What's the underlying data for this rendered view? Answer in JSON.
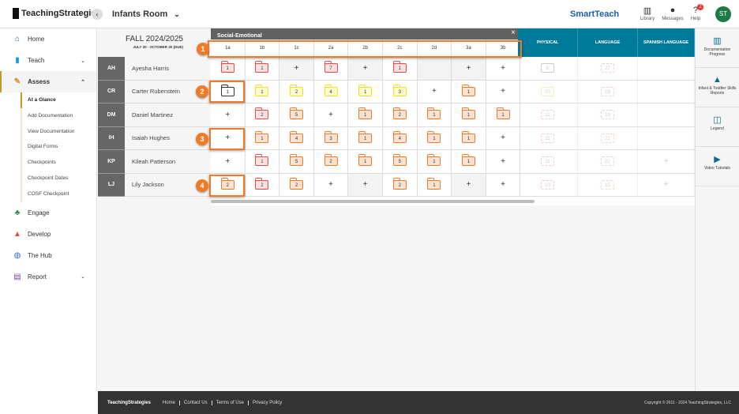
{
  "app": {
    "logo": "TeachingStrategies",
    "room": "Infants Room",
    "product": "SmartTeach",
    "library": "Library",
    "messages": "Messages",
    "help": "Help",
    "help_badge": "2",
    "avatar": "ST"
  },
  "sidebar": {
    "items": [
      {
        "label": "Home",
        "icon": "home-icon",
        "glyph": "⌂",
        "color": "#1a4f8c"
      },
      {
        "label": "Teach",
        "icon": "book-icon",
        "glyph": "▮",
        "color": "#1a9ad6",
        "chev": "⌄"
      },
      {
        "label": "Assess",
        "icon": "clipboard-icon",
        "glyph": "✎",
        "color": "#c8962c",
        "chev": "⌃"
      },
      {
        "label": "Engage",
        "icon": "people-icon",
        "glyph": "♣",
        "color": "#2a8a4a"
      },
      {
        "label": "Develop",
        "icon": "graduation-cap-icon",
        "glyph": "▲",
        "color": "#e84a2a"
      },
      {
        "label": "The Hub",
        "icon": "globe-icon",
        "glyph": "◍",
        "color": "#2a6ac8"
      },
      {
        "label": "Report",
        "icon": "bar-chart-icon",
        "glyph": "▤",
        "color": "#7a4aa8",
        "chev": "⌄"
      }
    ],
    "assess_sub": [
      "At a Glance",
      "Add Documentation",
      "View Documentation",
      "Digital Forms",
      "Checkpoints",
      "Checkpoint Dates",
      "COSF Checkpoint"
    ]
  },
  "season": {
    "title": "FALL 2024/2025",
    "dates": "JULY 30 - OCTOBER 30 (DUE)"
  },
  "domain": "Social-Emotional",
  "close": "×",
  "columns": [
    "1a",
    "1b",
    "1c",
    "2a",
    "2b",
    "2c",
    "2d",
    "3a",
    "3b"
  ],
  "other_domains": [
    "PHYSICAL",
    "LANGUAGE",
    "SPANISH LANGUAGE"
  ],
  "colors": {
    "accent": "#f07a28",
    "domain_header": "#007a99",
    "red": "#e84a4a",
    "orange": "#f07a28",
    "yellow": "#f0e020"
  },
  "students": [
    {
      "initials": "AH",
      "name": "Ayesha Harris",
      "cells": [
        [
          "r",
          "1"
        ],
        [
          "r",
          "1"
        ],
        [
          "+",
          ""
        ],
        [
          "r",
          "7"
        ],
        [
          "+",
          ""
        ],
        [
          "r",
          "1"
        ],
        [
          "",
          ""
        ],
        [
          "+",
          ""
        ],
        [
          "+",
          ""
        ]
      ],
      "other": [
        [
          "fg",
          "8"
        ],
        [
          "fr",
          "27"
        ],
        [
          "",
          ""
        ]
      ]
    },
    {
      "initials": "CR",
      "name": "Carter Rubenstein",
      "cells": [
        [
          "k",
          "1"
        ],
        [
          "y",
          "1"
        ],
        [
          "y",
          "2"
        ],
        [
          "y",
          "4"
        ],
        [
          "y",
          "1"
        ],
        [
          "y",
          "3"
        ],
        [
          "+",
          ""
        ],
        [
          "o",
          "1"
        ],
        [
          "+",
          ""
        ]
      ],
      "other": [
        [
          "fy",
          "20"
        ],
        [
          "fo",
          "19"
        ],
        [
          "",
          ""
        ]
      ]
    },
    {
      "initials": "DM",
      "name": "Daniel Martinez",
      "cells": [
        [
          "+",
          ""
        ],
        [
          "r",
          "2"
        ],
        [
          "o",
          "5"
        ],
        [
          "+",
          ""
        ],
        [
          "o",
          "1"
        ],
        [
          "o",
          "2"
        ],
        [
          "o",
          "1"
        ],
        [
          "o",
          "1"
        ],
        [
          "o",
          "1"
        ]
      ],
      "other": [
        [
          "fr",
          "11"
        ],
        [
          "fr",
          "19"
        ],
        [
          "",
          ""
        ]
      ]
    },
    {
      "initials": "IH",
      "name": "Isaiah Hughes",
      "cells": [
        [
          "+",
          ""
        ],
        [
          "o",
          "1"
        ],
        [
          "o",
          "4"
        ],
        [
          "o",
          "3"
        ],
        [
          "o",
          "1"
        ],
        [
          "o",
          "4"
        ],
        [
          "o",
          "1"
        ],
        [
          "o",
          "1"
        ],
        [
          "+",
          ""
        ]
      ],
      "other": [
        [
          "fr",
          "11"
        ],
        [
          "fo",
          "21"
        ],
        [
          "",
          ""
        ]
      ]
    },
    {
      "initials": "KP",
      "name": "Kileah Patterson",
      "cells": [
        [
          "+",
          ""
        ],
        [
          "r",
          "1"
        ],
        [
          "o",
          "5"
        ],
        [
          "o",
          "2"
        ],
        [
          "o",
          "1"
        ],
        [
          "o",
          "5"
        ],
        [
          "o",
          "1"
        ],
        [
          "o",
          "1"
        ],
        [
          "+",
          ""
        ]
      ],
      "other": [
        [
          "fr",
          "11"
        ],
        [
          "fr",
          "22"
        ],
        [
          "+",
          ""
        ]
      ]
    },
    {
      "initials": "LJ",
      "name": "Lily Jackson",
      "cells": [
        [
          "o",
          "2"
        ],
        [
          "r",
          "2"
        ],
        [
          "o",
          "2"
        ],
        [
          "+",
          ""
        ],
        [
          "+",
          ""
        ],
        [
          "o",
          "2"
        ],
        [
          "o",
          "1"
        ],
        [
          "+",
          ""
        ],
        [
          "+",
          ""
        ]
      ],
      "other": [
        [
          "fr",
          "10"
        ],
        [
          "fo",
          "15"
        ],
        [
          "+",
          ""
        ]
      ]
    }
  ],
  "right_panel": [
    {
      "label": "Documentation Progress",
      "icon": "bar-chart-icon",
      "glyph": "▥"
    },
    {
      "label": "Infant & Toddler Skills Reports",
      "icon": "shapes-icon",
      "glyph": "▲"
    },
    {
      "label": "Legend",
      "icon": "map-icon",
      "glyph": "◫"
    },
    {
      "label": "Video Tutorials",
      "icon": "play-icon",
      "glyph": "▶"
    }
  ],
  "callouts": [
    "1",
    "2",
    "3",
    "4"
  ],
  "footer": {
    "logo": "TeachingStrategies",
    "links": [
      "Home",
      "Contact Us",
      "Terms of Use",
      "Privacy Policy"
    ],
    "copyright": "Copyright © 2011 - 2024 TeachingStrategies, LLC"
  }
}
